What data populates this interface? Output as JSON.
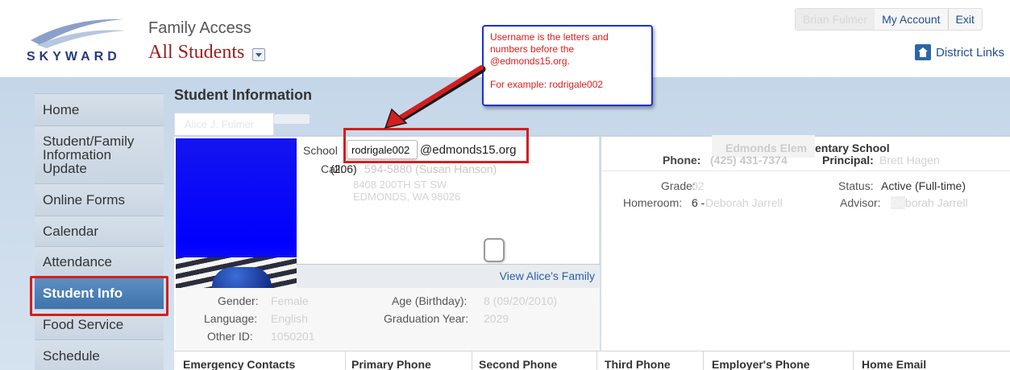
{
  "header": {
    "logo_text": "SKYWARD",
    "app_title": "Family Access",
    "student_selector": "All Students",
    "user_name": "Brian Fulmer",
    "my_account": "My Account",
    "exit": "Exit",
    "district_links": "District Links"
  },
  "sidebar": {
    "items": [
      {
        "label": "Home"
      },
      {
        "label": "Student/Family Information Update"
      },
      {
        "label": "Online Forms"
      },
      {
        "label": "Calendar"
      },
      {
        "label": "Attendance"
      },
      {
        "label": "Student Info"
      },
      {
        "label": "Food Service"
      },
      {
        "label": "Schedule"
      }
    ],
    "active": "Student Info"
  },
  "main": {
    "heading": "Student Information",
    "student_tab": "Alice J. Fulmer",
    "school_label": "School",
    "username_value": "rodrigale002",
    "email_domain": "@edmonds15.org",
    "call_label": "Call:",
    "call_area": "(206)",
    "call_rest": "594-5880 (Susan Hanson)",
    "address_line1": "8408 200TH ST SW",
    "address_line2": "EDMONDS, WA 98026",
    "view_family": "View Alice's Family",
    "details": {
      "gender_label": "Gender:",
      "gender": "Female",
      "language_label": "Language:",
      "language": "English",
      "other_id_label": "Other ID:",
      "other_id": "1050201",
      "age_label": "Age (Birthday):",
      "age": "8 (09/20/2010)",
      "grad_label": "Graduation Year:",
      "grad_year": "2029"
    },
    "school": {
      "name_ghost": "Edmonds Elem",
      "name_tail": "entary School",
      "phone_label": "Phone:",
      "phone": "(425) 431-7374",
      "principal_label": "Principal:",
      "principal": "Brett Hagen",
      "grade_label": "Grade:",
      "grade": "02",
      "homeroom_label": "Homeroom:",
      "homeroom_num": "6 -",
      "homeroom_teacher": "Deborah Jarrell",
      "status_label": "Status:",
      "status": "Active (Full-time)",
      "advisor_label": "Advisor:",
      "advisor_ghost": "De",
      "advisor": "borah Jarrell"
    },
    "contacts_columns": [
      "Emergency Contacts",
      "Primary Phone",
      "Second Phone",
      "Third Phone",
      "Employer's Phone",
      "Home Email"
    ]
  },
  "callout": {
    "line1": "Username is the letters and numbers before the @edmonds15.org.",
    "line2": "For example: rodrigale002"
  },
  "colors": {
    "annotation_red": "#d21f1f",
    "callout_border": "#1a2ee0",
    "active_nav": "#4a7fb8",
    "link_blue": "#1f4e9a"
  }
}
